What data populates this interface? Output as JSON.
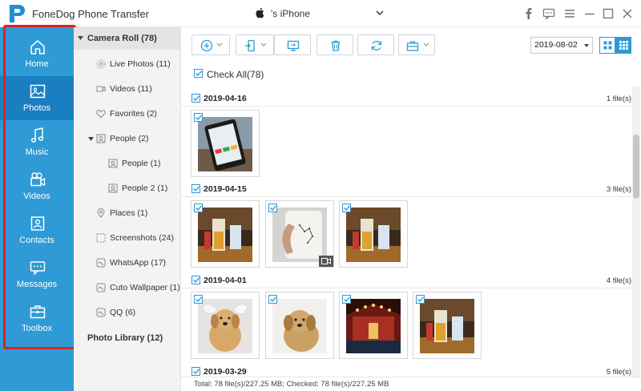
{
  "app": {
    "title": "FoneDog Phone Transfer"
  },
  "device": {
    "name": "'s iPhone"
  },
  "window_controls": [
    "facebook-icon",
    "feedback-icon",
    "menu-icon",
    "minimize-icon",
    "maximize-icon",
    "close-icon"
  ],
  "nav": {
    "items": [
      {
        "label": "Home",
        "icon": "home-icon",
        "active": false
      },
      {
        "label": "Photos",
        "icon": "photos-icon",
        "active": true
      },
      {
        "label": "Music",
        "icon": "music-icon",
        "active": false
      },
      {
        "label": "Videos",
        "icon": "videos-icon",
        "active": false
      },
      {
        "label": "Contacts",
        "icon": "contacts-icon",
        "active": false
      },
      {
        "label": "Messages",
        "icon": "messages-icon",
        "active": false
      },
      {
        "label": "Toolbox",
        "icon": "toolbox-icon",
        "active": false
      }
    ]
  },
  "tree": {
    "root": "Camera Roll (78)",
    "items": [
      {
        "label": "Live Photos (11)",
        "icon": "live-photos-icon"
      },
      {
        "label": "Videos (11)",
        "icon": "video-icon"
      },
      {
        "label": "Favorites (2)",
        "icon": "heart-icon"
      },
      {
        "label": "People (2)",
        "icon": "people-icon"
      },
      {
        "label": "People (1)",
        "icon": "person-icon"
      },
      {
        "label": "People 2 (1)",
        "icon": "person-icon"
      },
      {
        "label": "Places (1)",
        "icon": "location-icon"
      },
      {
        "label": "Screenshots (24)",
        "icon": "screenshot-icon"
      },
      {
        "label": "WhatsApp (17)",
        "icon": "album-icon"
      },
      {
        "label": "Cuto Wallpaper (1)",
        "icon": "album-icon"
      },
      {
        "label": "QQ (6)",
        "icon": "album-icon"
      }
    ],
    "library": "Photo Library (12)"
  },
  "toolbar": {
    "buttons": [
      "add-icon",
      "export-to-device-icon",
      "export-to-pc-icon",
      "delete-icon",
      "refresh-icon",
      "toolbox-icon"
    ],
    "date_value": "2019-08-02"
  },
  "check_all": {
    "label": "Check All(78)"
  },
  "groups": [
    {
      "date": "2019-04-16",
      "count": "1 file(s)",
      "thumbs": [
        "phone"
      ]
    },
    {
      "date": "2019-04-15",
      "count": "3 file(s)",
      "thumbs": [
        "drinks",
        "mug",
        "drinks"
      ]
    },
    {
      "date": "2019-04-01",
      "count": "4 file(s)",
      "thumbs": [
        "dog-wings",
        "dog",
        "stage",
        "drinks"
      ]
    },
    {
      "date": "2019-03-29",
      "count": "5 file(s)",
      "thumbs": []
    }
  ],
  "status": {
    "text": "Total: 78 file(s)/227.25 MB; Checked: 78 file(s)/227.25 MB"
  },
  "colors": {
    "accent": "#2e9ad6",
    "nav_active": "#1a7fc0",
    "highlight": "#e0201f"
  }
}
